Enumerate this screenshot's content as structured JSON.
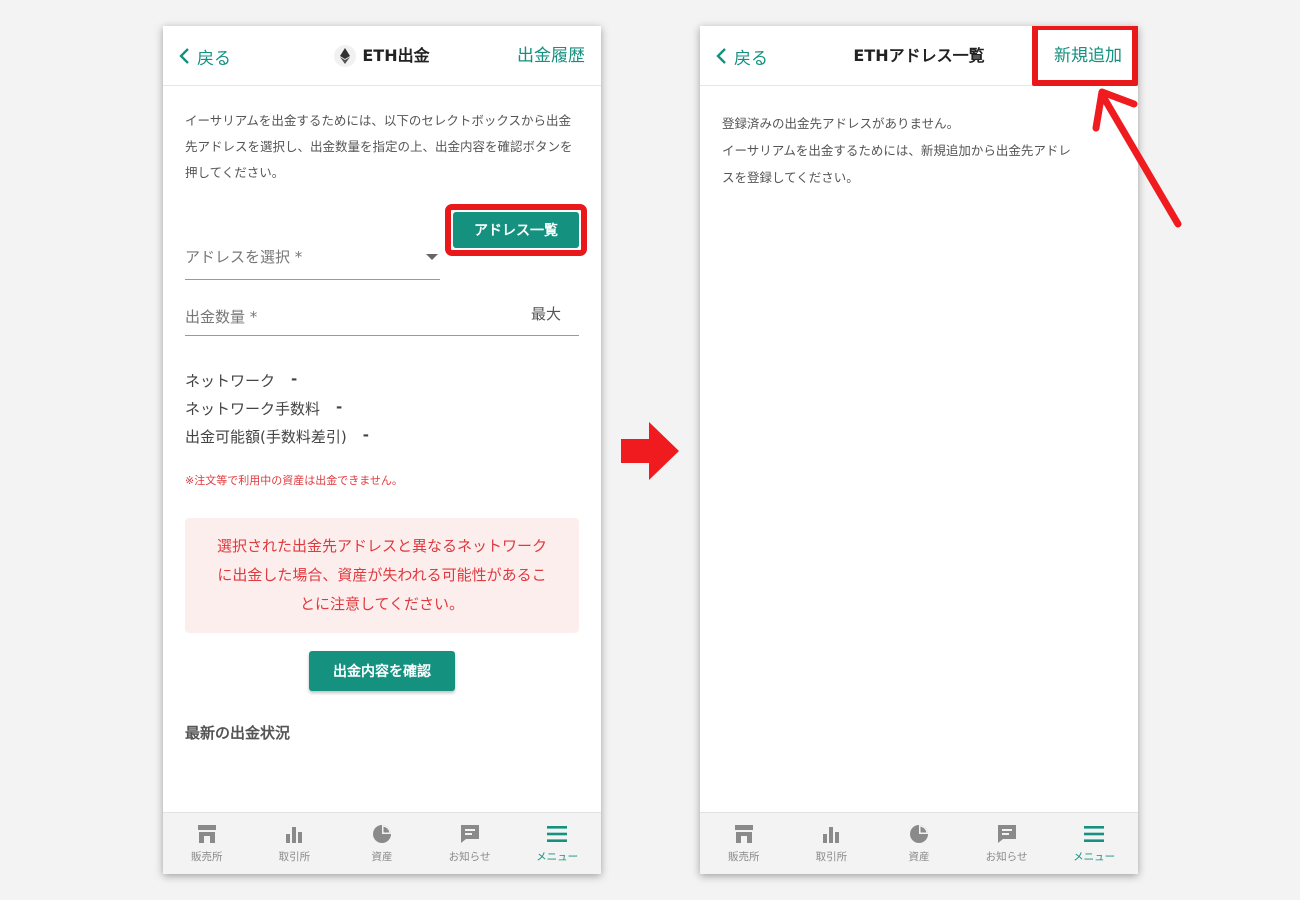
{
  "colors": {
    "accent": "#14917f",
    "highlight": "#e8181b",
    "warning_text": "#e0393e",
    "warning_bg": "#fdeeee"
  },
  "left": {
    "back_label": "戻る",
    "title": "ETH出金",
    "header_right": "出金履歴",
    "intro": "イーサリアムを出金するためには、以下のセレクトボックスから出金先アドレスを選択し、出金数量を指定の上、出金内容を確認ボタンを押してください。",
    "address_select_placeholder": "アドレスを選択 *",
    "address_list_button": "アドレス一覧",
    "amount_placeholder": "出金数量 *",
    "max_label": "最大",
    "info": [
      {
        "label": "ネットワーク",
        "value": "-"
      },
      {
        "label": "ネットワーク手数料",
        "value": "-"
      },
      {
        "label": "出金可能額(手数料差引)",
        "value": "-"
      }
    ],
    "note": "※注文等で利用中の資産は出金できません。",
    "warning_lines": [
      "選択された出金先アドレスと異なるネットワーク",
      "に出金した場合、資産が失われる可能性があるこ",
      "とに注意してください。"
    ],
    "confirm_button": "出金内容を確認",
    "latest_title": "最新の出金状況"
  },
  "right": {
    "back_label": "戻る",
    "title": "ETHアドレス一覧",
    "header_right": "新規追加",
    "empty_lines": [
      "登録済みの出金先アドレスがありません。",
      "イーサリアムを出金するためには、新規追加から出金先アドレ",
      "スを登録してください。"
    ]
  },
  "tabs": [
    {
      "label": "販売所",
      "icon": "store-icon",
      "active": false
    },
    {
      "label": "取引所",
      "icon": "bar-chart-icon",
      "active": false
    },
    {
      "label": "資産",
      "icon": "pie-chart-icon",
      "active": false
    },
    {
      "label": "お知らせ",
      "icon": "message-icon",
      "active": false
    },
    {
      "label": "メニュー",
      "icon": "menu-icon",
      "active": true
    }
  ]
}
